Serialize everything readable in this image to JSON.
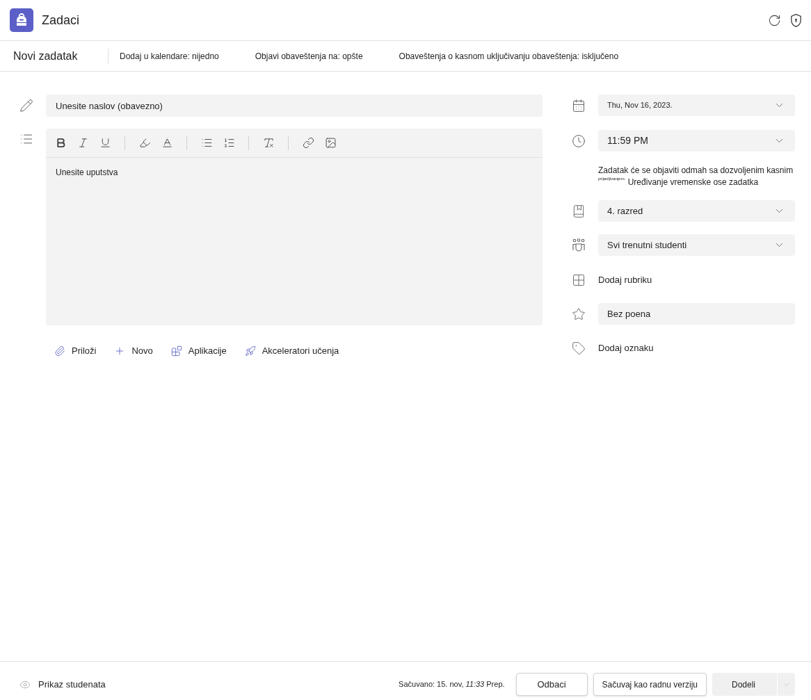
{
  "header": {
    "title": "Zadaci"
  },
  "command_bar": {
    "title": "Novi zadatak",
    "settings": [
      "Dodaj u kalendare: nijedno",
      "Objavi obaveštenja na: opšte",
      "Obaveštenja o kasnom uključivanju obaveštenja: isključeno"
    ]
  },
  "title_field": {
    "placeholder": "Unesite naslov (obavezno)"
  },
  "instructions_field": {
    "placeholder": "Unesite uputstva"
  },
  "attachment_actions": [
    "Priloži",
    "Novo",
    "Aplikacije",
    "Akceleratori učenja"
  ],
  "due_date": {
    "value": "Thu, Nov 16, 2023."
  },
  "due_time": {
    "value": "11:59 PM"
  },
  "schedule_note": {
    "text": "Zadatak će se objaviti odmah sa dozvoljenim kasnim $^{prijavljivanjem.}$",
    "link": "Uređivanje vremenske ose zadatka"
  },
  "class": {
    "value": "4. razred"
  },
  "students": {
    "value": "Svi trenutni studenti"
  },
  "rubric": {
    "label": "Dodaj rubriku"
  },
  "points": {
    "placeholder": "Bez poena"
  },
  "tag": {
    "label": "Dodaj oznaku"
  },
  "footer": {
    "student_view": "Prikaz studenata",
    "saved": "Sačuvano: 15. nov, *11:33* Prep.",
    "buttons": {
      "discard": "Odbaci",
      "save_draft": "Sačuvaj kao radnu verziju",
      "assign": "Dodeli"
    }
  }
}
